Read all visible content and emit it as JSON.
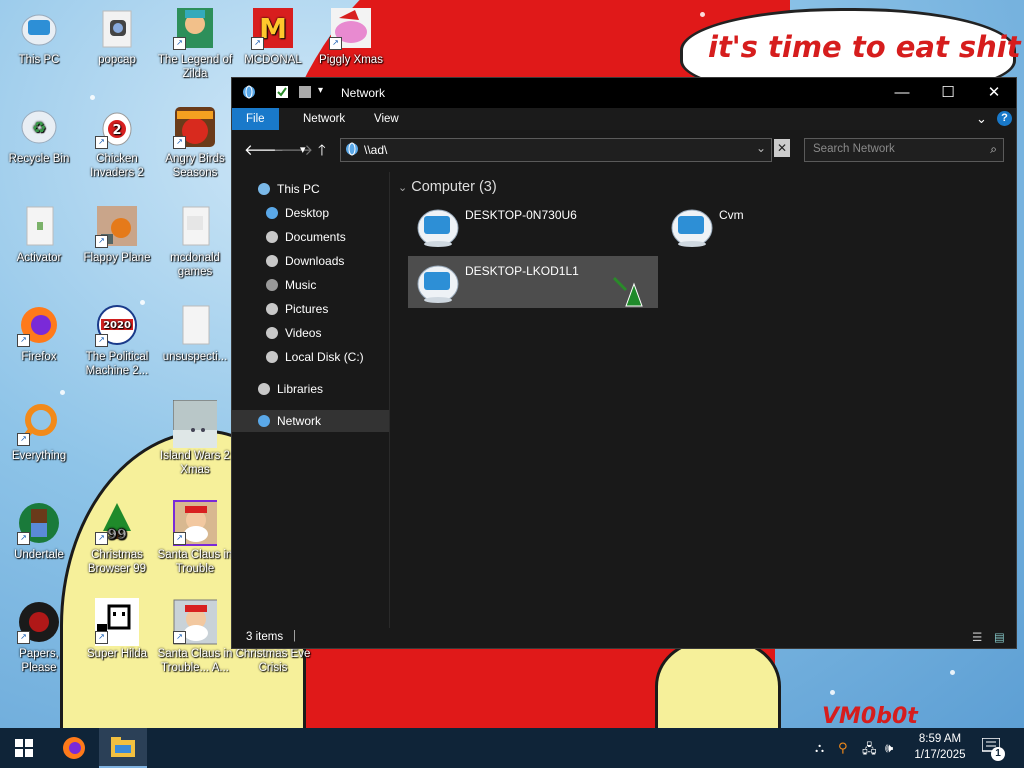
{
  "desktop": {
    "icons": [
      {
        "label": "This PC",
        "icon": "this-pc-icon"
      },
      {
        "label": "popcap",
        "icon": "folder-icon"
      },
      {
        "label": "The Legend of Zilda",
        "icon": "zilda-game-icon"
      },
      {
        "label": "MCDONAL",
        "icon": "mcdonalds-icon"
      },
      {
        "label": "Piggly Xmas",
        "icon": "piggly-xmas-icon"
      },
      {
        "label": "Recycle Bin",
        "icon": "recycle-bin-icon"
      },
      {
        "label": "Chicken Invaders 2",
        "icon": "chicken-invaders-icon"
      },
      {
        "label": "Angry Birds Seasons",
        "icon": "angry-birds-icon"
      },
      {
        "label": "Activator",
        "icon": "folder-icon"
      },
      {
        "label": "Flappy Plane",
        "icon": "flappy-plane-icon"
      },
      {
        "label": "mcdonald games",
        "icon": "folder-icon"
      },
      {
        "label": "Firefox",
        "icon": "firefox-icon"
      },
      {
        "label": "The Political Machine 2...",
        "icon": "political-machine-icon"
      },
      {
        "label": "unsuspecti...",
        "icon": "folder-icon"
      },
      {
        "label": "Everything",
        "icon": "everything-search-icon"
      },
      {
        "label": "Island Wars 2 Xmas",
        "icon": "island-wars-icon"
      },
      {
        "label": "Undertale",
        "icon": "undertale-icon"
      },
      {
        "label": "Christmas Browser 99",
        "icon": "christmas-tree-icon"
      },
      {
        "label": "Santa Claus in Trouble",
        "icon": "santa-claus-icon"
      },
      {
        "label": "Papers, Please",
        "icon": "papers-please-icon"
      },
      {
        "label": "Super Hilda",
        "icon": "super-hilda-icon"
      },
      {
        "label": "Santa Claus in Trouble... A...",
        "icon": "santa-claus-icon"
      },
      {
        "label": "Christmas Eve Crisis",
        "icon": "blank-shortcut-icon"
      }
    ],
    "wallpaper_text": "it's time to eat shit",
    "wallpaper_signature": "VM0b0t"
  },
  "explorer": {
    "title": "Network",
    "ribbon_tabs": [
      "File",
      "Network",
      "View"
    ],
    "address": "\\\\ad\\",
    "search_placeholder": "Search Network",
    "nav": [
      {
        "label": "This PC",
        "icon": "this-pc-icon"
      },
      {
        "label": "Desktop",
        "icon": "desktop-icon"
      },
      {
        "label": "Documents",
        "icon": "documents-icon"
      },
      {
        "label": "Downloads",
        "icon": "downloads-icon"
      },
      {
        "label": "Music",
        "icon": "music-icon"
      },
      {
        "label": "Pictures",
        "icon": "pictures-icon"
      },
      {
        "label": "Videos",
        "icon": "videos-icon"
      },
      {
        "label": "Local Disk (C:)",
        "icon": "disk-icon"
      },
      {
        "label": "Libraries",
        "icon": "libraries-icon"
      },
      {
        "label": "Network",
        "icon": "network-icon",
        "selected": true
      }
    ],
    "group_header": "Computer (3)",
    "items": [
      {
        "label": "DESKTOP-0N730U6",
        "icon": "computer-icon"
      },
      {
        "label": "Cvm",
        "icon": "computer-icon"
      },
      {
        "label": "DESKTOP-LKOD1L1",
        "icon": "computer-icon",
        "selected": true
      }
    ],
    "status": "3 items"
  },
  "taskbar": {
    "time": "8:59 AM",
    "date": "1/17/2025",
    "notification_count": "1"
  },
  "colors": {
    "accent": "#1979ca",
    "taskbar": "#0f2438",
    "explorer_bg": "#191919"
  }
}
